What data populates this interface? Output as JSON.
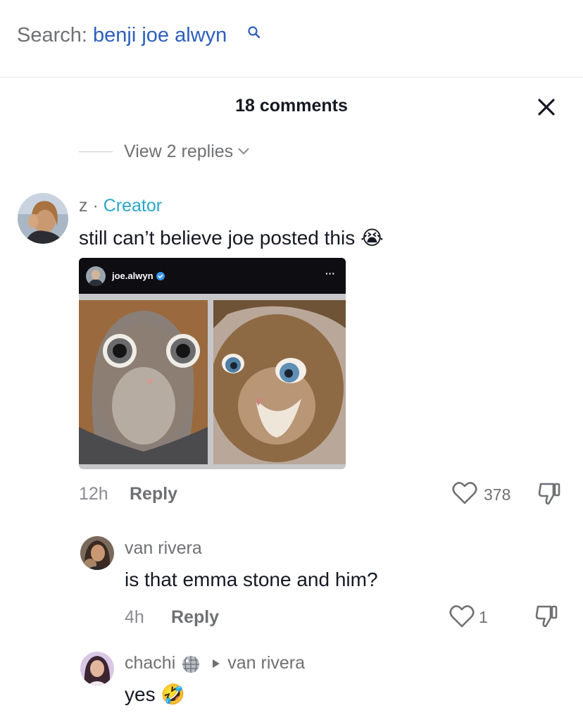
{
  "search": {
    "prefix": "Search: ",
    "query": "benji joe alwyn"
  },
  "panel": {
    "title": "18 comments"
  },
  "view_replies": {
    "label": "View 2 replies"
  },
  "comments": [
    {
      "username": "z",
      "separator": " · ",
      "tag": "Creator",
      "text": "still can’t believe joe posted this 😭",
      "embed": {
        "handle": "joe.alwyn",
        "more": "···"
      },
      "time": "12h",
      "reply_label": "Reply",
      "likes": "378"
    },
    {
      "username": "van rivera",
      "text": "is that emma stone and him?",
      "time": "4h",
      "reply_label": "Reply",
      "likes": "1"
    },
    {
      "username": "chachi",
      "reply_to": "van rivera",
      "text": "yes 🤣"
    }
  ],
  "colors": {
    "creator_tag": "#2aa6c9",
    "search_query": "#2c5fbd",
    "text_primary": "#161823",
    "text_secondary": "#6f7073"
  },
  "icons": [
    "search-icon",
    "close-icon",
    "chevron-down-icon",
    "heart-icon",
    "dislike-icon",
    "disco-ball-icon",
    "play-arrow-icon",
    "verified-icon"
  ]
}
